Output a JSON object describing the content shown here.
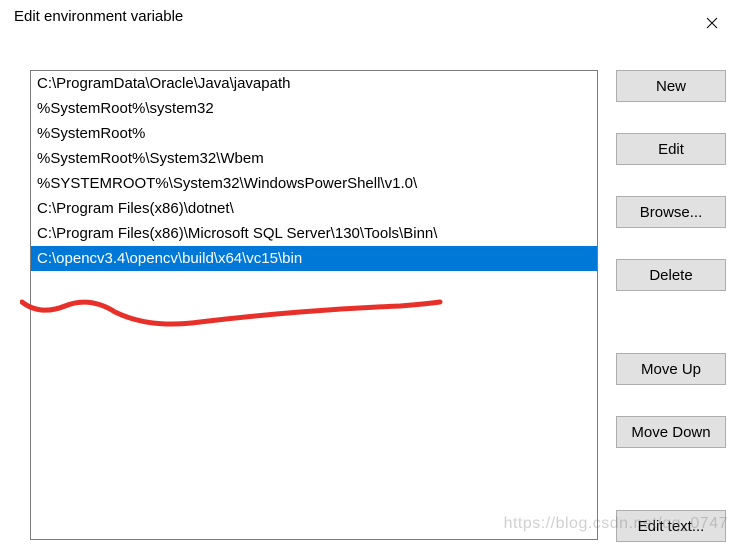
{
  "titlebar": {
    "title": "Edit environment variable"
  },
  "list": {
    "items": [
      "C:\\ProgramData\\Oracle\\Java\\javapath",
      "%SystemRoot%\\system32",
      "%SystemRoot%",
      "%SystemRoot%\\System32\\Wbem",
      "%SYSTEMROOT%\\System32\\WindowsPowerShell\\v1.0\\",
      "C:\\Program Files(x86)\\dotnet\\",
      "C:\\Program Files(x86)\\Microsoft SQL Server\\130\\Tools\\Binn\\",
      "C:\\opencv3.4\\opencv\\build\\x64\\vc15\\bin"
    ],
    "selected_index": 7
  },
  "buttons": {
    "new": "New",
    "edit": "Edit",
    "browse": "Browse...",
    "delete": "Delete",
    "move_up": "Move Up",
    "move_down": "Move Down",
    "edit_text": "Edit text..."
  },
  "watermark": "https://blog.csdn.net/qq_0747"
}
